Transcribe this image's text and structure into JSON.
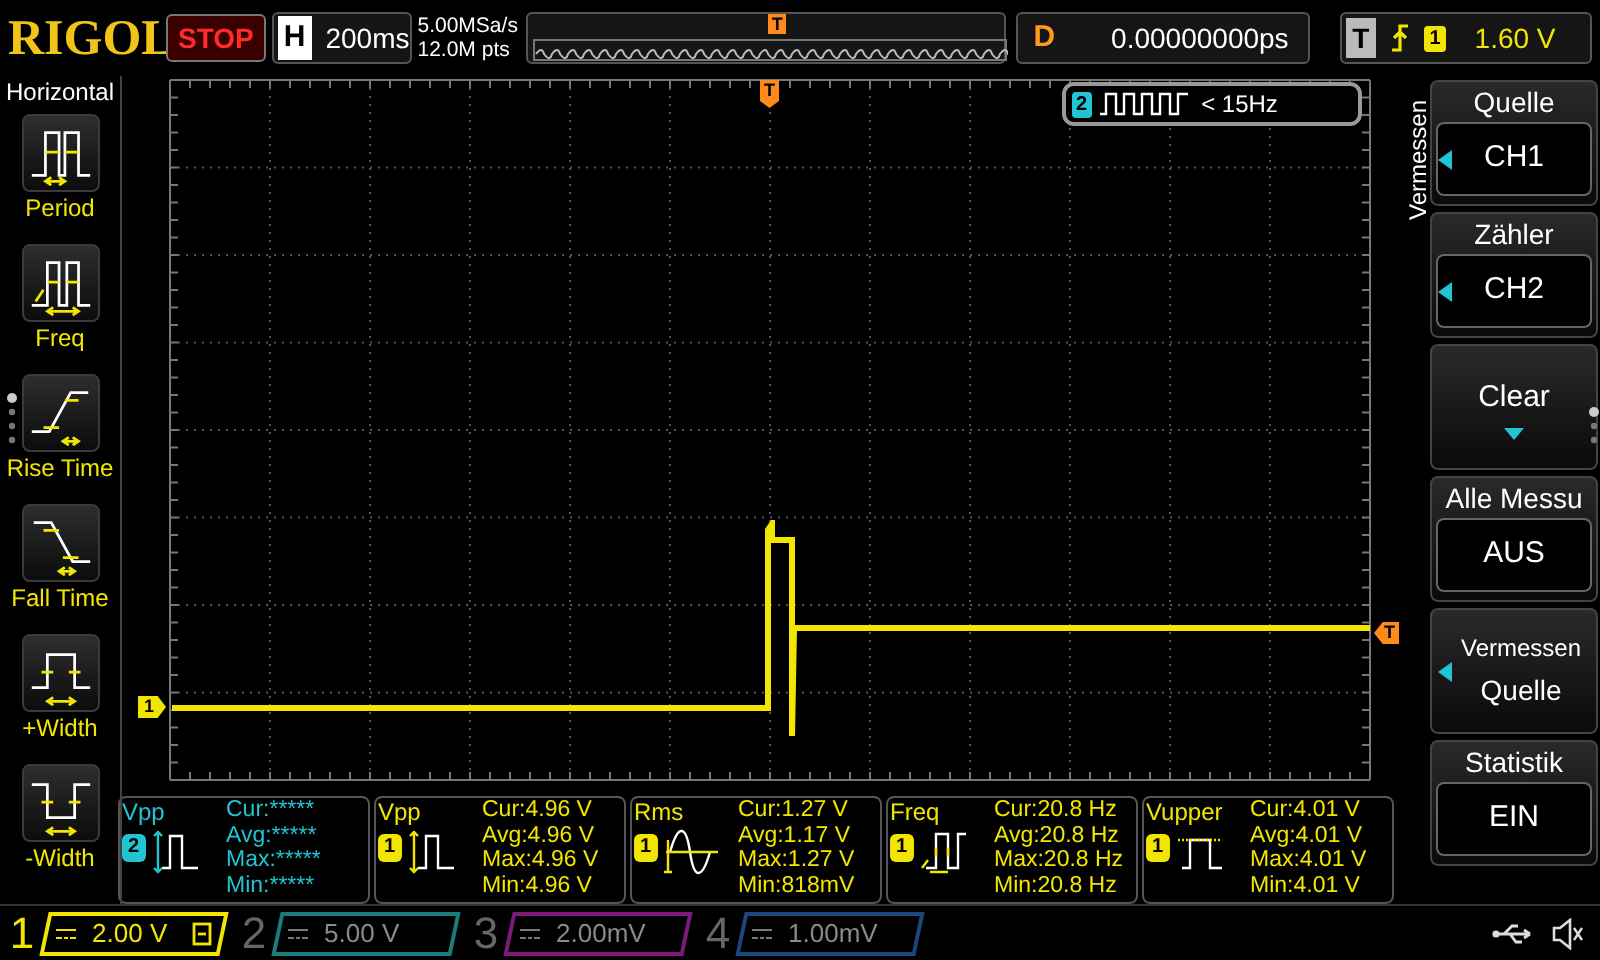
{
  "brand": "RIGOL",
  "run_state": "STOP",
  "horizontal": {
    "label": "H",
    "timebase": "200ms"
  },
  "acquisition": {
    "sample_rate": "5.00MSa/s",
    "memory_depth": "12.0M pts"
  },
  "trigger_position_marker": "T",
  "delay": {
    "label": "D",
    "value": "0.00000000ps"
  },
  "trigger": {
    "label": "T",
    "channel": "1",
    "level": "1.60 V"
  },
  "left_menu": {
    "title": "Horizontal",
    "items": [
      {
        "label": "Period",
        "kind": "period"
      },
      {
        "label": "Freq",
        "kind": "freq"
      },
      {
        "label": "Rise Time",
        "kind": "rise"
      },
      {
        "label": "Fall Time",
        "kind": "fall"
      },
      {
        "label": "+Width",
        "kind": "pwidth"
      },
      {
        "label": "-Width",
        "kind": "nwidth"
      }
    ]
  },
  "plot": {
    "channel_marker": "1",
    "top_trigger_marker": "T",
    "side_trigger_marker": "T",
    "counter": {
      "channel": "2",
      "text": "< 15Hz"
    }
  },
  "right_menu": {
    "title": "Vermessen",
    "items": [
      {
        "kind": "select",
        "label": "Quelle",
        "value": "CH1"
      },
      {
        "kind": "select",
        "label": "Zähler",
        "value": "CH2"
      },
      {
        "kind": "action",
        "label": "Clear"
      },
      {
        "kind": "toggle",
        "label": "Alle Messu",
        "value": "AUS"
      },
      {
        "kind": "stacked",
        "label": "Vermessen",
        "value": "Quelle"
      },
      {
        "kind": "toggle",
        "label": "Statistik",
        "value": "EIN"
      }
    ]
  },
  "measurements": [
    {
      "name": "Vpp",
      "channel": "2",
      "color": "#22c4d4",
      "kind": "pulse",
      "stats": [
        "Cur:*****",
        "Avg:*****",
        "Max:*****",
        "Min:*****"
      ]
    },
    {
      "name": "Vpp",
      "channel": "1",
      "color": "#f2e600",
      "kind": "pulse",
      "stats": [
        "Cur:4.96 V",
        "Avg:4.96 V",
        "Max:4.96 V",
        "Min:4.96 V"
      ]
    },
    {
      "name": "Rms",
      "channel": "1",
      "color": "#f2e600",
      "kind": "sine",
      "stats": [
        "Cur:1.27 V",
        "Avg:1.17 V",
        "Max:1.27 V",
        "Min:818mV"
      ]
    },
    {
      "name": "Freq",
      "channel": "1",
      "color": "#f2e600",
      "kind": "freq",
      "stats": [
        "Cur:20.8 Hz",
        "Avg:20.8 Hz",
        "Max:20.8 Hz",
        "Min:20.8 Hz"
      ]
    },
    {
      "name": "Vupper",
      "channel": "1",
      "color": "#f2e600",
      "kind": "top",
      "stats": [
        "Cur:4.01 V",
        "Avg:4.01 V",
        "Max:4.01 V",
        "Min:4.01 V"
      ]
    }
  ],
  "channels": [
    {
      "number": "1",
      "scale": "2.00 V",
      "active": true,
      "color": "#f2e600"
    },
    {
      "number": "2",
      "scale": "5.00 V",
      "active": false,
      "color": "#1f8a8a"
    },
    {
      "number": "3",
      "scale": "2.00mV",
      "active": false,
      "color": "#8a1f8a"
    },
    {
      "number": "4",
      "scale": "1.00mV",
      "active": false,
      "color": "#1f4f8a"
    }
  ]
}
